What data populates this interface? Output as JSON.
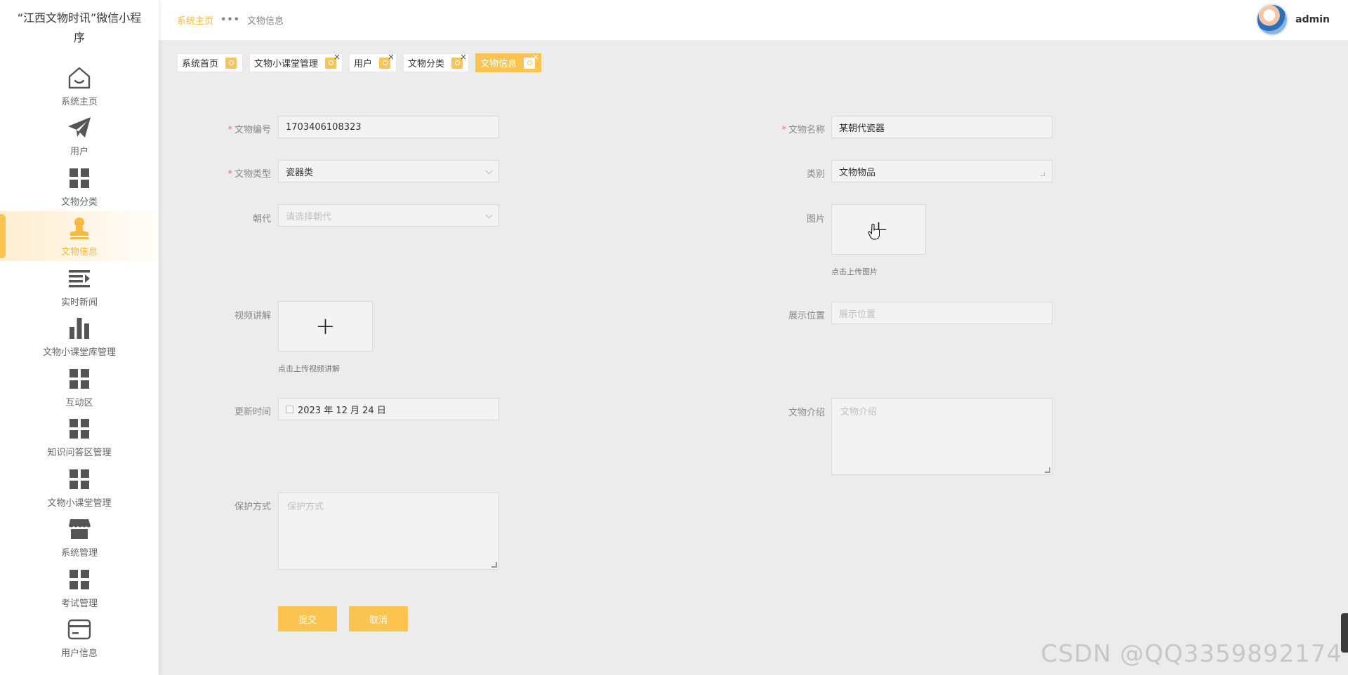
{
  "sidebar": {
    "app_title": "“江西文物时讯”微信小程序",
    "items": [
      {
        "label": "系统主页",
        "icon": "home-icon"
      },
      {
        "label": "用户",
        "icon": "paper-plane-icon"
      },
      {
        "label": "文物分类",
        "icon": "grid-icon"
      },
      {
        "label": "文物信息",
        "icon": "stamp-icon",
        "active": true
      },
      {
        "label": "实时新闻",
        "icon": "list-icon"
      },
      {
        "label": "文物小课堂库管理",
        "icon": "bar-chart-icon"
      },
      {
        "label": "互动区",
        "icon": "grid-icon"
      },
      {
        "label": "知识问答区管理",
        "icon": "grid-icon"
      },
      {
        "label": "文物小课堂管理",
        "icon": "grid-icon"
      },
      {
        "label": "系统管理",
        "icon": "shop-icon"
      },
      {
        "label": "考试管理",
        "icon": "grid-icon"
      },
      {
        "label": "用户信息",
        "icon": "card-icon"
      }
    ]
  },
  "header": {
    "breadcrumb_home": "系统主页",
    "breadcrumb_sep": "•••",
    "breadcrumb_current": "文物信息",
    "username": "admin"
  },
  "tabs": [
    {
      "label": "系统首页",
      "closable": false
    },
    {
      "label": "文物小课堂管理",
      "closable": true
    },
    {
      "label": "用户",
      "closable": true
    },
    {
      "label": "文物分类",
      "closable": true
    },
    {
      "label": "文物信息",
      "closable": true,
      "active": true
    }
  ],
  "form": {
    "code_label": "文物编号",
    "code_value": "1703406108323",
    "name_label": "文物名称",
    "name_value": "某朝代瓷器",
    "type_label": "文物类型",
    "type_value": "瓷器类",
    "category_label": "类别",
    "category_value": "文物物品",
    "dynasty_label": "朝代",
    "dynasty_placeholder": "请选择朝代",
    "image_label": "图片",
    "image_hint": "点击上传图片",
    "video_label": "视频讲解",
    "video_hint": "点击上传视频讲解",
    "location_label": "展示位置",
    "location_placeholder": "展示位置",
    "update_label": "更新时间",
    "update_value": "2023 年 12 月 24 日",
    "intro_label": "文物介绍",
    "intro_placeholder": "文物介绍",
    "protect_label": "保护方式",
    "protect_placeholder": "保护方式",
    "required_mark": "*",
    "plus": "+",
    "submit_label": "提交",
    "cancel_label": "取消"
  },
  "watermark": "CSDN @QQ3359892174",
  "colors": {
    "accent": "#fbc450",
    "required": "#f56c6c",
    "background": "#ececec"
  }
}
